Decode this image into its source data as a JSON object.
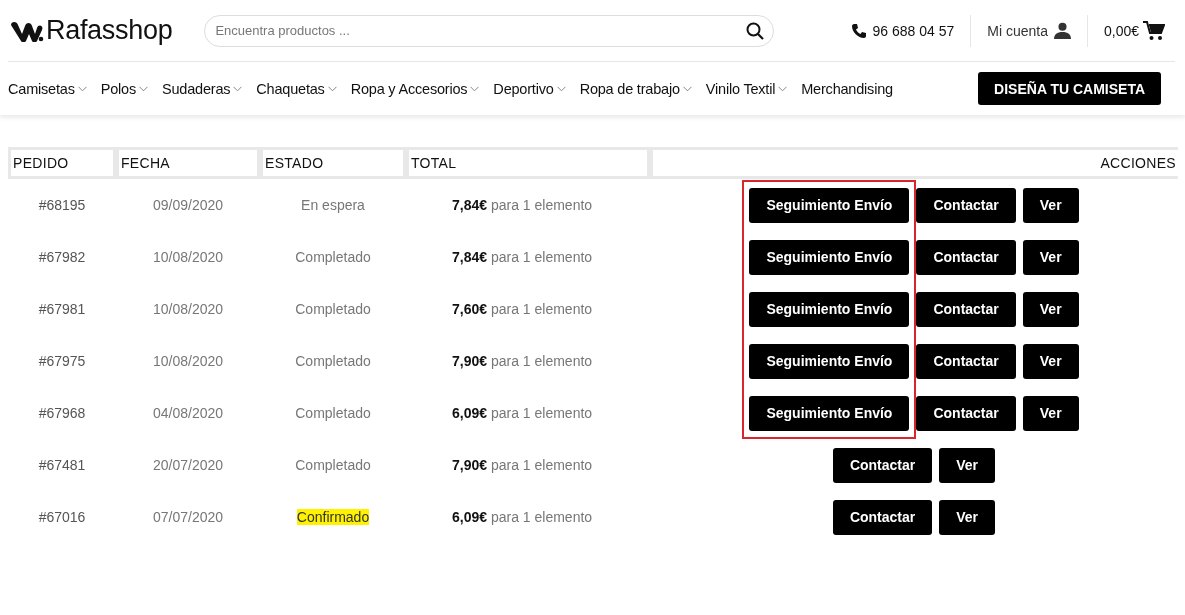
{
  "logo": {
    "text": "Rafasshop"
  },
  "search": {
    "placeholder": "Encuentra productos ..."
  },
  "phone": "96 688 04 57",
  "account": "Mi cuenta",
  "cart": "0,00€",
  "nav": {
    "items": [
      {
        "label": "Camisetas",
        "submenu": true
      },
      {
        "label": "Polos",
        "submenu": true
      },
      {
        "label": "Sudaderas",
        "submenu": true
      },
      {
        "label": "Chaquetas",
        "submenu": true
      },
      {
        "label": "Ropa y Accesorios",
        "submenu": true
      },
      {
        "label": "Deportivo",
        "submenu": true
      },
      {
        "label": "Ropa de trabajo",
        "submenu": true
      },
      {
        "label": "Vinilo Textil",
        "submenu": true
      },
      {
        "label": "Merchandising",
        "submenu": false
      }
    ],
    "cta": "DISEÑA TU CAMISETA"
  },
  "orders": {
    "columns": [
      "PEDIDO",
      "FECHA",
      "ESTADO",
      "TOTAL",
      "ACCIONES"
    ],
    "rows": [
      {
        "order": "#68195",
        "date": "09/09/2020",
        "status": "En espera",
        "highlighted": false,
        "amount": "7,84€",
        "items": "para 1 elemento",
        "actions": [
          {
            "kind": "tracking",
            "label": "Seguimiento Envío"
          },
          {
            "kind": "contact",
            "label": "Contactar"
          },
          {
            "kind": "view",
            "label": "Ver"
          }
        ]
      },
      {
        "order": "#67982",
        "date": "10/08/2020",
        "status": "Completado",
        "highlighted": false,
        "amount": "7,84€",
        "items": "para 1 elemento",
        "actions": [
          {
            "kind": "tracking",
            "label": "Seguimiento Envío"
          },
          {
            "kind": "contact",
            "label": "Contactar"
          },
          {
            "kind": "view",
            "label": "Ver"
          }
        ]
      },
      {
        "order": "#67981",
        "date": "10/08/2020",
        "status": "Completado",
        "highlighted": false,
        "amount": "7,60€",
        "items": "para 1 elemento",
        "actions": [
          {
            "kind": "tracking",
            "label": "Seguimiento Envío"
          },
          {
            "kind": "contact",
            "label": "Contactar"
          },
          {
            "kind": "view",
            "label": "Ver"
          }
        ]
      },
      {
        "order": "#67975",
        "date": "10/08/2020",
        "status": "Completado",
        "highlighted": false,
        "amount": "7,90€",
        "items": "para 1 elemento",
        "actions": [
          {
            "kind": "tracking",
            "label": "Seguimiento Envío"
          },
          {
            "kind": "contact",
            "label": "Contactar"
          },
          {
            "kind": "view",
            "label": "Ver"
          }
        ]
      },
      {
        "order": "#67968",
        "date": "04/08/2020",
        "status": "Completado",
        "highlighted": false,
        "amount": "6,09€",
        "items": "para 1 elemento",
        "actions": [
          {
            "kind": "tracking",
            "label": "Seguimiento Envío"
          },
          {
            "kind": "contact",
            "label": "Contactar"
          },
          {
            "kind": "view",
            "label": "Ver"
          }
        ]
      },
      {
        "order": "#67481",
        "date": "20/07/2020",
        "status": "Completado",
        "highlighted": false,
        "amount": "7,90€",
        "items": "para 1 elemento",
        "actions": [
          {
            "kind": "contact",
            "label": "Contactar"
          },
          {
            "kind": "view",
            "label": "Ver"
          }
        ]
      },
      {
        "order": "#67016",
        "date": "07/07/2020",
        "status": "Confirmado",
        "highlighted": true,
        "amount": "6,09€",
        "items": "para 1 elemento",
        "actions": [
          {
            "kind": "contact",
            "label": "Contactar"
          },
          {
            "kind": "view",
            "label": "Ver"
          }
        ]
      }
    ]
  },
  "annotation": {
    "kind": "frame",
    "color": "#d9262c"
  }
}
